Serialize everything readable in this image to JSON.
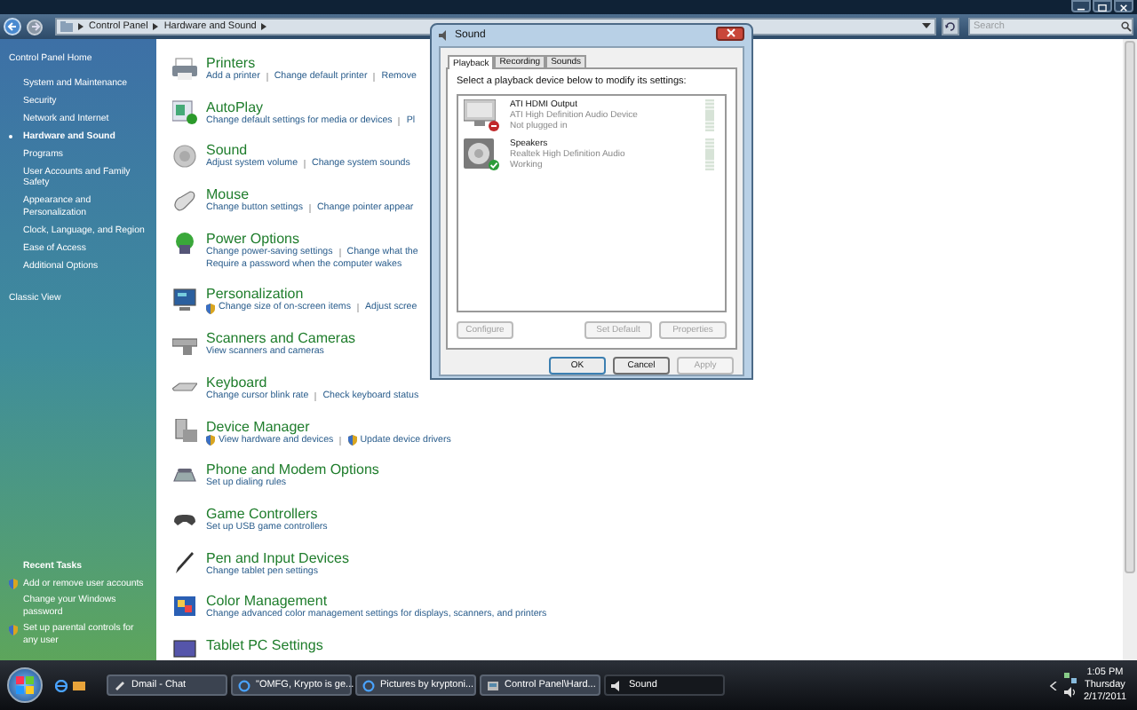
{
  "address_bar": {
    "breadcrumbs": [
      "Control Panel",
      "Hardware and Sound"
    ]
  },
  "search": {
    "placeholder": "Search"
  },
  "sidebar": {
    "home": "Control Panel Home",
    "items": [
      {
        "label": "System and Maintenance",
        "selected": false
      },
      {
        "label": "Security",
        "selected": false
      },
      {
        "label": "Network and Internet",
        "selected": false
      },
      {
        "label": "Hardware and Sound",
        "selected": true
      },
      {
        "label": "Programs",
        "selected": false
      },
      {
        "label": "User Accounts and Family Safety",
        "selected": false
      },
      {
        "label": "Appearance and Personalization",
        "selected": false
      },
      {
        "label": "Clock, Language, and Region",
        "selected": false
      },
      {
        "label": "Ease of Access",
        "selected": false
      },
      {
        "label": "Additional Options",
        "selected": false
      }
    ],
    "classic_view": "Classic View",
    "recent_tasks": {
      "title": "Recent Tasks",
      "items": [
        {
          "label": "Add or remove user accounts",
          "shield": true
        },
        {
          "label": "Change your Windows password",
          "shield": false
        },
        {
          "label": "Set up parental controls for any user",
          "shield": true
        }
      ]
    }
  },
  "categories": [
    {
      "title": "Printers",
      "lines": [
        [
          {
            "text": "Add a printer",
            "shield": false
          },
          {
            "text": "Change default printer",
            "shield": false
          },
          {
            "text": "Remove",
            "shield": false
          }
        ]
      ]
    },
    {
      "title": "AutoPlay",
      "lines": [
        [
          {
            "text": "Change default settings for media or devices",
            "shield": false
          },
          {
            "text": "Pl",
            "shield": false
          }
        ]
      ]
    },
    {
      "title": "Sound",
      "lines": [
        [
          {
            "text": "Adjust system volume",
            "shield": false
          },
          {
            "text": "Change system sounds",
            "shield": false
          }
        ]
      ]
    },
    {
      "title": "Mouse",
      "lines": [
        [
          {
            "text": "Change button settings",
            "shield": false
          },
          {
            "text": "Change pointer appear",
            "shield": false
          }
        ]
      ]
    },
    {
      "title": "Power Options",
      "lines": [
        [
          {
            "text": "Change power-saving settings",
            "shield": false
          },
          {
            "text": "Change what the",
            "shield": false
          }
        ],
        [
          {
            "text": "Require a password when the computer wakes",
            "shield": false
          }
        ]
      ]
    },
    {
      "title": "Personalization",
      "lines": [
        [
          {
            "text": "Change size of on-screen items",
            "shield": true
          },
          {
            "text": "Adjust scree",
            "shield": false
          }
        ]
      ]
    },
    {
      "title": "Scanners and Cameras",
      "lines": [
        [
          {
            "text": "View scanners and cameras",
            "shield": false
          }
        ]
      ]
    },
    {
      "title": "Keyboard",
      "lines": [
        [
          {
            "text": "Change cursor blink rate",
            "shield": false
          },
          {
            "text": "Check keyboard status",
            "shield": false
          }
        ]
      ]
    },
    {
      "title": "Device Manager",
      "lines": [
        [
          {
            "text": "View hardware and devices",
            "shield": true
          },
          {
            "text": "Update device drivers",
            "shield": true
          }
        ]
      ]
    },
    {
      "title": "Phone and Modem Options",
      "lines": [
        [
          {
            "text": "Set up dialing rules",
            "shield": false
          }
        ]
      ]
    },
    {
      "title": "Game Controllers",
      "lines": [
        [
          {
            "text": "Set up USB game controllers",
            "shield": false
          }
        ]
      ]
    },
    {
      "title": "Pen and Input Devices",
      "lines": [
        [
          {
            "text": "Change tablet pen settings",
            "shield": false
          }
        ]
      ]
    },
    {
      "title": "Color Management",
      "lines": [
        [
          {
            "text": "Change advanced color management settings for displays, scanners, and printers",
            "shield": false
          }
        ]
      ]
    },
    {
      "title": "Tablet PC Settings"
    }
  ],
  "dialog": {
    "title": "Sound",
    "tabs": [
      {
        "label": "Playback",
        "selected": true
      },
      {
        "label": "Recording",
        "selected": false
      },
      {
        "label": "Sounds",
        "selected": false
      }
    ],
    "instruction": "Select a playback device below to modify its settings:",
    "devices": [
      {
        "name": "ATI HDMI Output",
        "driver": "ATI High Definition Audio Device",
        "status": "Not plugged in",
        "kind": "unplugged",
        "level": 0
      },
      {
        "name": "Speakers",
        "driver": "Realtek High Definition Audio",
        "status": "Working",
        "kind": "working",
        "level": 0
      }
    ],
    "device_buttons": [
      {
        "label": "Configure",
        "disabled": true
      },
      {
        "label": "Set Default",
        "disabled": true
      },
      {
        "label": "Properties",
        "disabled": true
      }
    ],
    "buttons": [
      {
        "label": "OK",
        "disabled": false,
        "default": true
      },
      {
        "label": "Cancel",
        "disabled": false,
        "default": false
      },
      {
        "label": "Apply",
        "disabled": true,
        "default": false
      }
    ]
  },
  "taskbar": {
    "buttons": [
      {
        "label": "Dmail - Chat",
        "selected": false
      },
      {
        "label": "\"OMFG, Krypto is ge...",
        "selected": false
      },
      {
        "label": "Pictures by kryptoni...",
        "selected": false
      },
      {
        "label": "Control Panel\\Hard...",
        "selected": false
      },
      {
        "label": "Sound",
        "selected": true
      }
    ],
    "clock": {
      "time": "1:05 PM",
      "day": "Thursday",
      "date": "2/17/2011"
    }
  }
}
